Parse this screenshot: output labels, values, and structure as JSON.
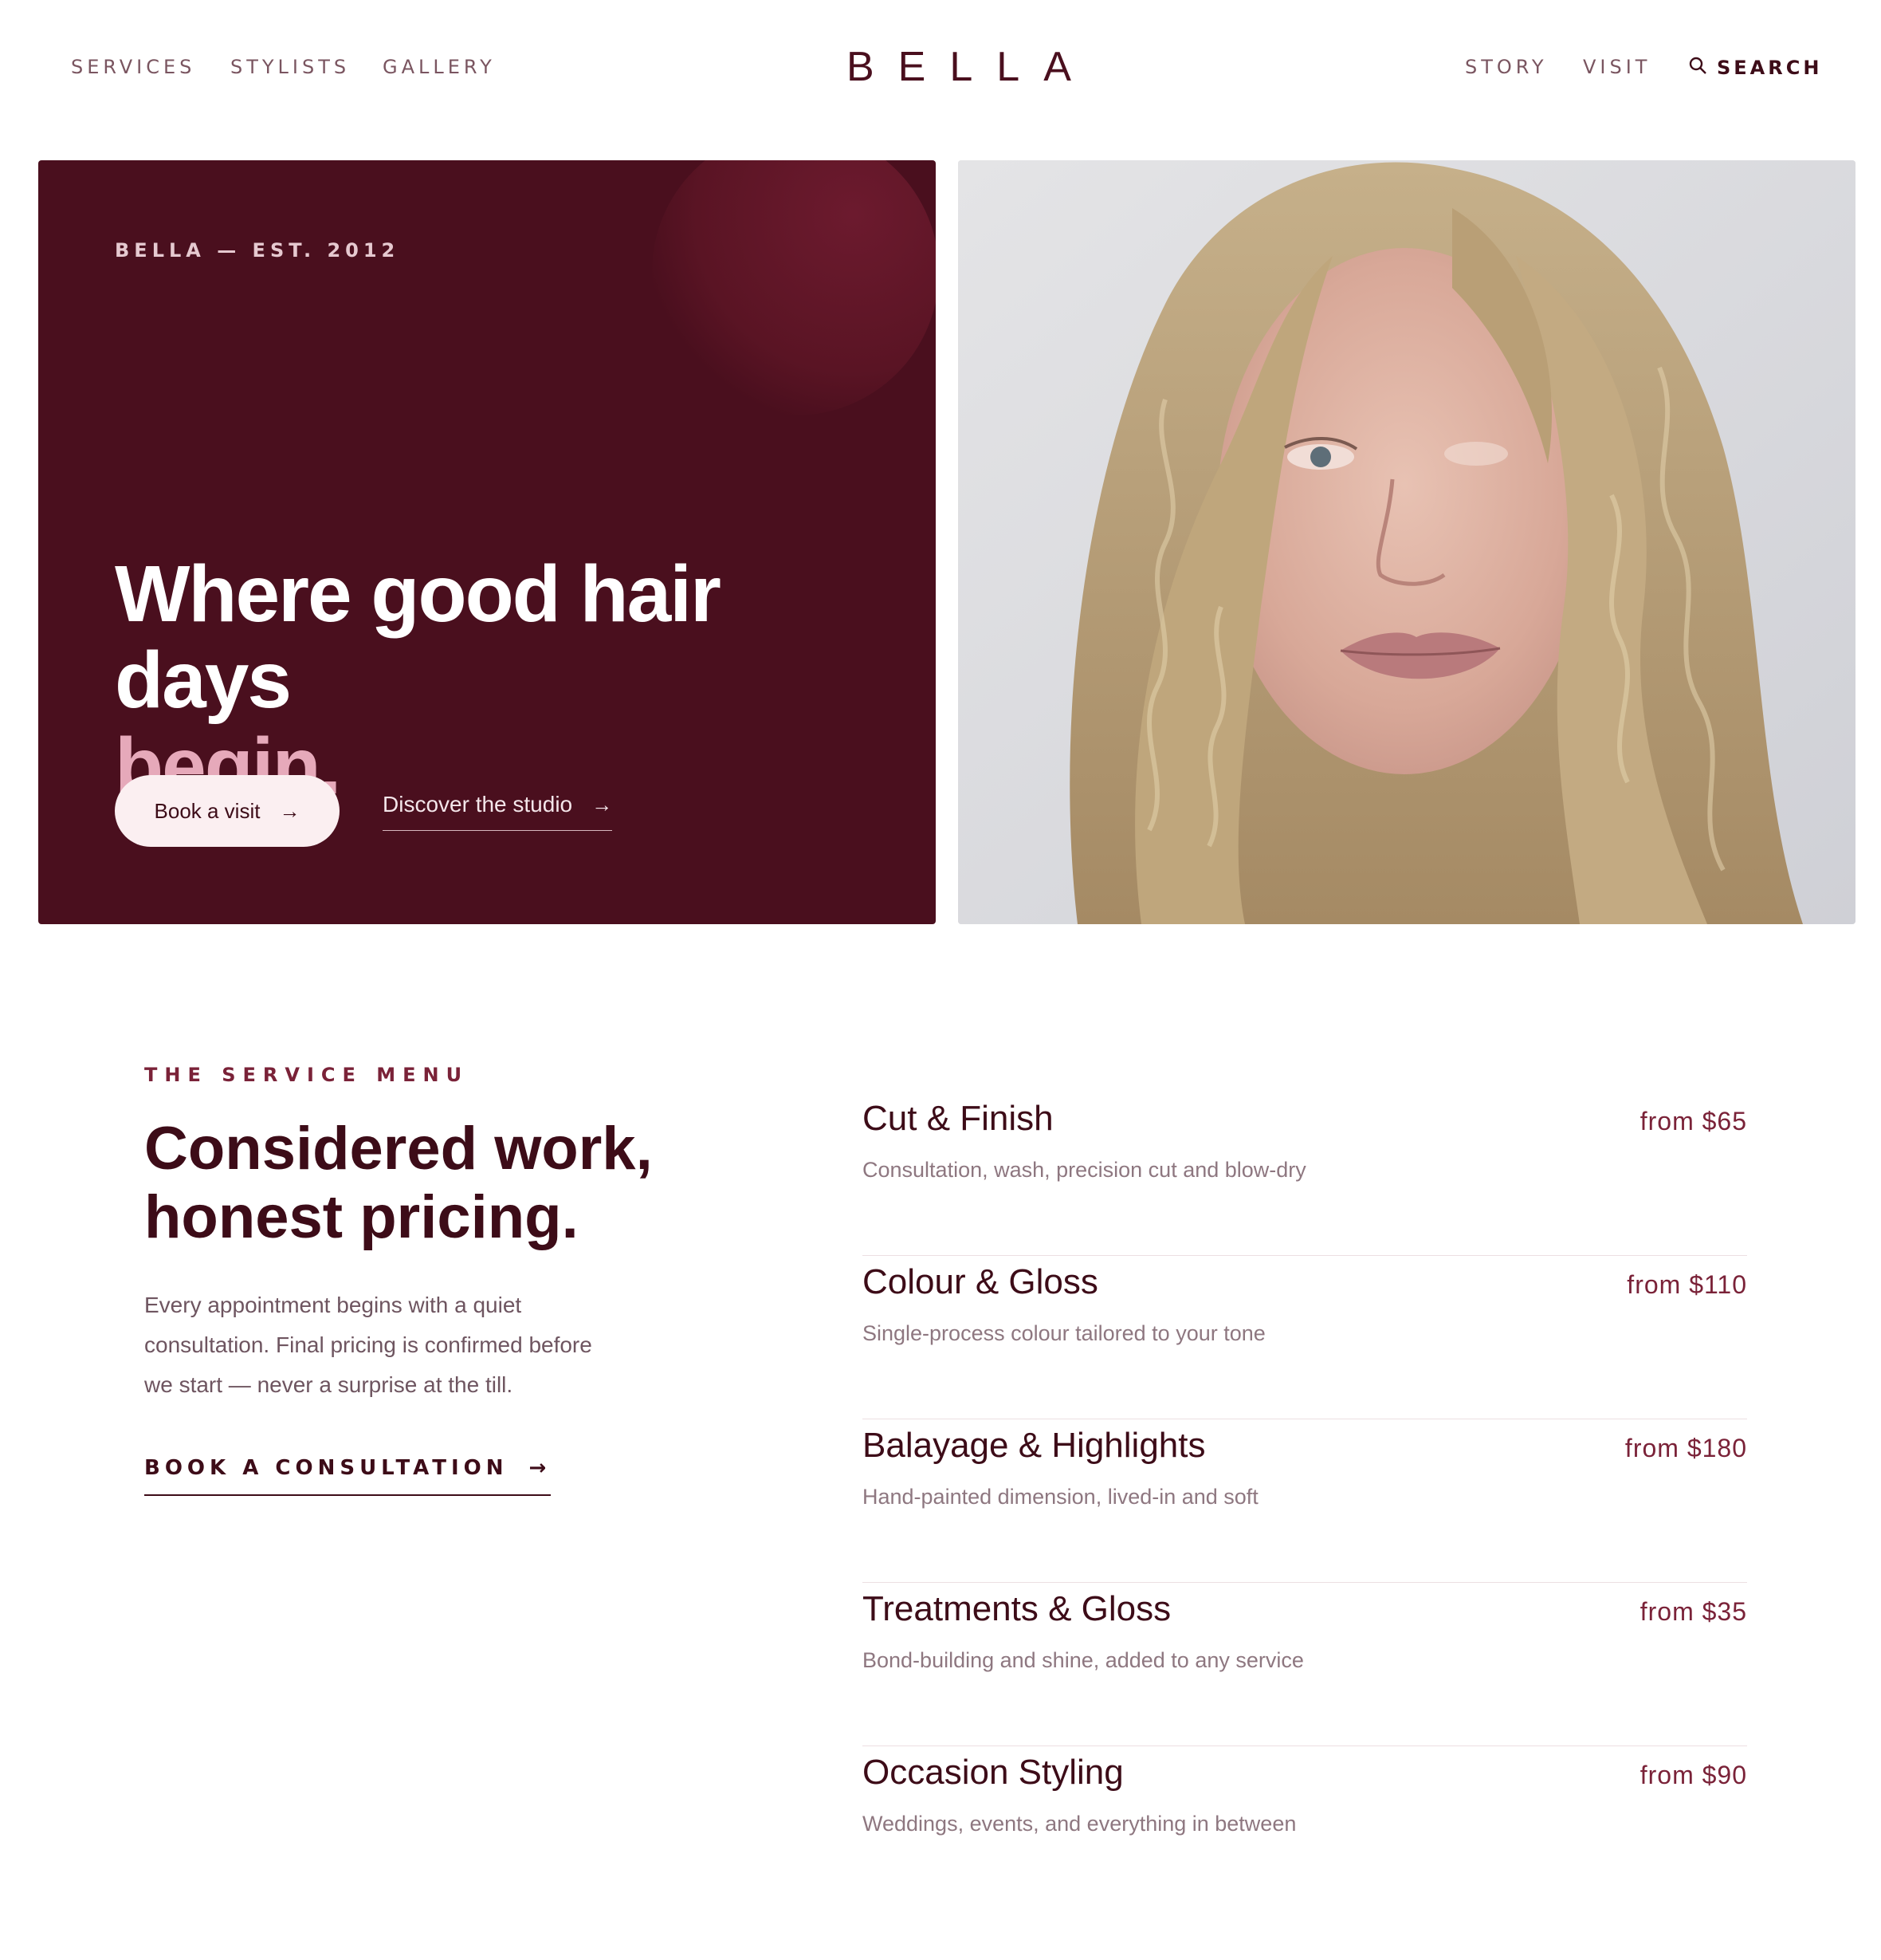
{
  "header": {
    "nav_left": [
      "SERVICES",
      "STYLISTS",
      "GALLERY"
    ],
    "logo": "BELLA",
    "nav_right": [
      "STORY",
      "VISIT"
    ],
    "search_label": "SEARCH"
  },
  "hero": {
    "eyebrow": "BELLA — EST. 2012",
    "title_line1": "Where good hair days",
    "title_line2": "begin.",
    "primary_button": "Book a visit",
    "secondary_link": "Discover the studio",
    "arrow": "→",
    "panel_color": "#4a0f1e",
    "accent_color": "#e6a9ba"
  },
  "service_menu": {
    "eyebrow": "THE SERVICE MENU",
    "heading_line1": "Considered work,",
    "heading_line2": "honest pricing.",
    "body": "Every appointment begins with a quiet consultation. Final pricing is confirmed before we start — never a surprise at the till.",
    "cta": "BOOK A CONSULTATION",
    "services": [
      {
        "name": "Cut & Finish",
        "price": "from $65",
        "desc": "Consultation, wash, precision cut and blow-dry"
      },
      {
        "name": "Colour & Gloss",
        "price": "from $110",
        "desc": "Single-process colour tailored to your tone"
      },
      {
        "name": "Balayage & Highlights",
        "price": "from $180",
        "desc": "Hand-painted dimension, lived-in and soft"
      },
      {
        "name": "Treatments & Gloss",
        "price": "from $35",
        "desc": "Bond-building and shine, added to any service"
      },
      {
        "name": "Occasion Styling",
        "price": "from $90",
        "desc": "Weddings, events, and everything in between"
      }
    ]
  }
}
